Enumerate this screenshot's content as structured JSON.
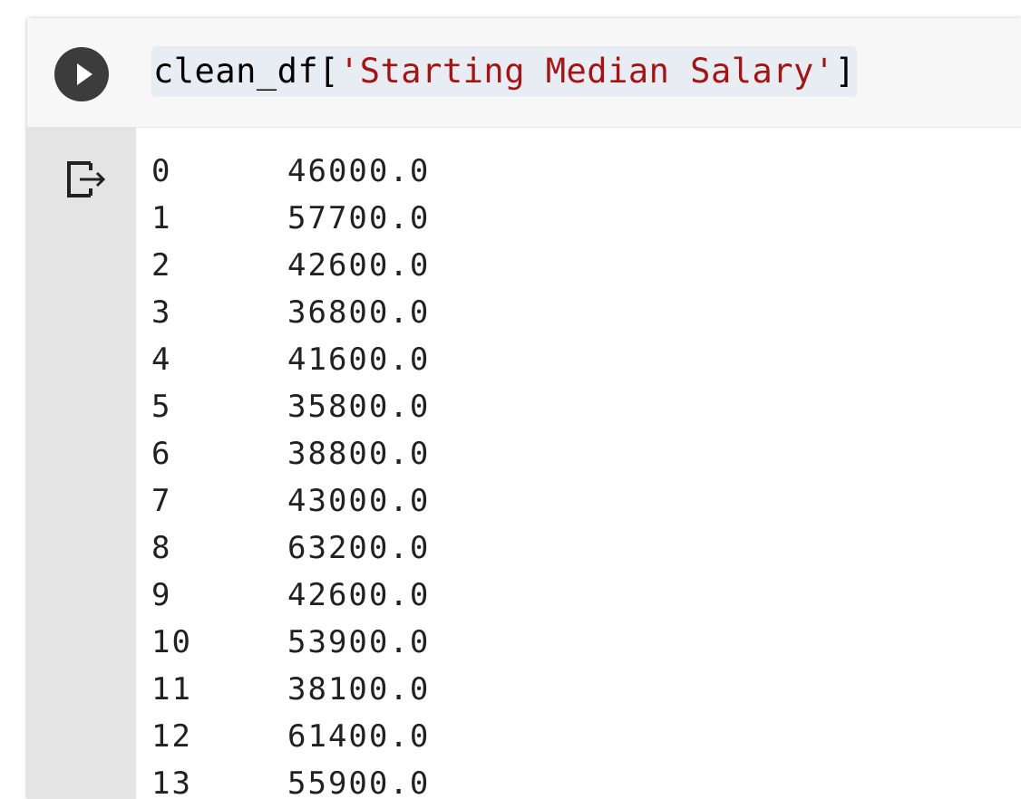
{
  "cell": {
    "code_prefix": "clean_df[",
    "code_string": "'Starting Median Salary'",
    "code_suffix": "]",
    "run_icon": "play-icon",
    "output_icon": "output-redirect-icon"
  },
  "output": {
    "rows": [
      {
        "index": "0",
        "value": "46000.0"
      },
      {
        "index": "1",
        "value": "57700.0"
      },
      {
        "index": "2",
        "value": "42600.0"
      },
      {
        "index": "3",
        "value": "36800.0"
      },
      {
        "index": "4",
        "value": "41600.0"
      },
      {
        "index": "5",
        "value": "35800.0"
      },
      {
        "index": "6",
        "value": "38800.0"
      },
      {
        "index": "7",
        "value": "43000.0"
      },
      {
        "index": "8",
        "value": "63200.0"
      },
      {
        "index": "9",
        "value": "42600.0"
      },
      {
        "index": "10",
        "value": "53900.0"
      },
      {
        "index": "11",
        "value": "38100.0"
      },
      {
        "index": "12",
        "value": "61400.0"
      },
      {
        "index": "13",
        "value": "55900.0"
      }
    ]
  },
  "colors": {
    "string_literal": "#a31515",
    "run_button": "#3c3c3c",
    "code_highlight": "#e8ecf3",
    "output_gutter": "#e4e4e4"
  }
}
